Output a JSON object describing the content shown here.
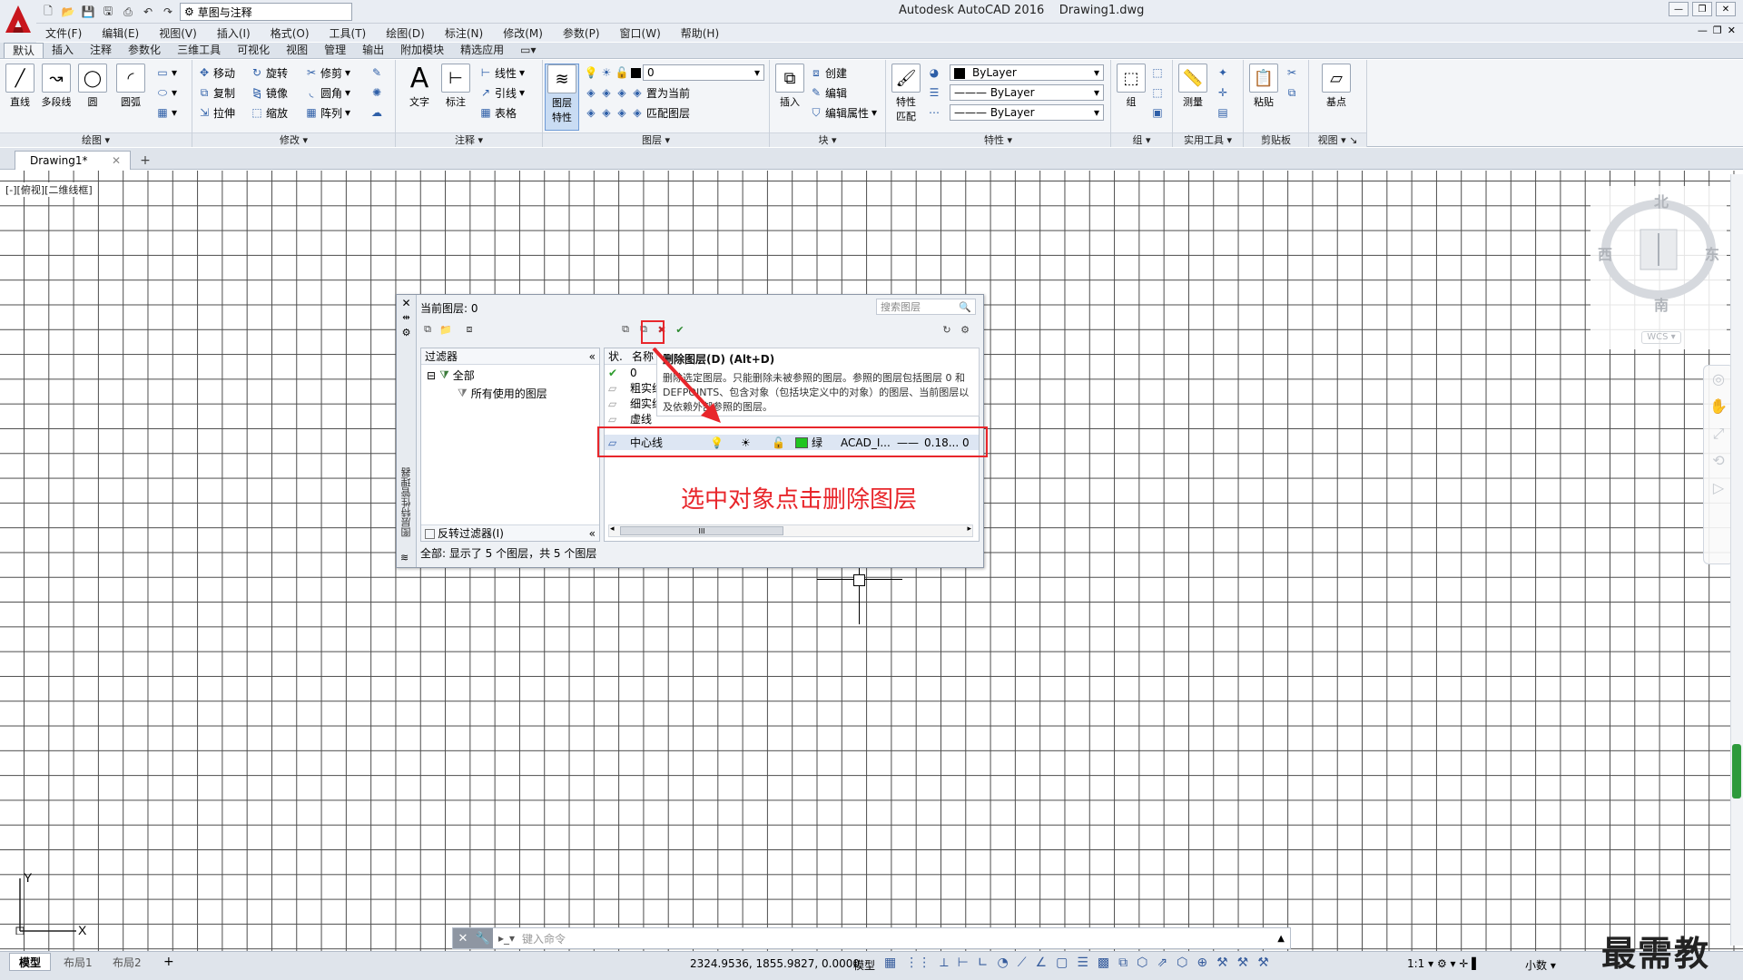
{
  "app": {
    "title": "Autodesk AutoCAD 2016    Drawing1.dwg",
    "workspace": "草图与注释"
  },
  "menus": [
    "文件(F)",
    "编辑(E)",
    "视图(V)",
    "插入(I)",
    "格式(O)",
    "工具(T)",
    "绘图(D)",
    "标注(N)",
    "修改(M)",
    "参数(P)",
    "窗口(W)",
    "帮助(H)"
  ],
  "ribbon_tabs": [
    "默认",
    "插入",
    "注释",
    "参数化",
    "三维工具",
    "可视化",
    "视图",
    "管理",
    "输出",
    "附加模块",
    "精选应用"
  ],
  "ribbon": {
    "draw": {
      "label": "绘图",
      "line": "直线",
      "polyline": "多段线",
      "circle": "圆",
      "arc": "圆弧"
    },
    "modify": {
      "label": "修改",
      "move": "移动",
      "rotate": "旋转",
      "trim": "修剪",
      "copy": "复制",
      "mirror": "镜像",
      "fillet": "圆角",
      "stretch": "拉伸",
      "scale": "缩放",
      "array": "阵列"
    },
    "annotation": {
      "label": "注释",
      "text": "文字",
      "dimension": "标注",
      "linear": "线性",
      "leader": "引线",
      "table": "表格"
    },
    "layers": {
      "label": "图层",
      "properties_line1": "图层",
      "properties_line2": "特性",
      "current_layer": "0",
      "set_current": "置为当前",
      "match": "匹配图层"
    },
    "block": {
      "label": "块",
      "insert": "插入",
      "create": "创建",
      "edit": "编辑",
      "edit_attr": "编辑属性"
    },
    "properties": {
      "label": "特性",
      "match_line1": "特性",
      "match_line2": "匹配",
      "color": "ByLayer",
      "linetype": "ByLayer",
      "lineweight": "ByLayer"
    },
    "groups": {
      "label": "组",
      "group": "组"
    },
    "utilities": {
      "label": "实用工具",
      "measure": "测量"
    },
    "clipboard": {
      "label": "剪贴板",
      "paste": "粘贴"
    },
    "view": {
      "label": "视图",
      "base": "基点"
    }
  },
  "document_tab": "Drawing1*",
  "viewport_label": "[-][俯视][二维线框]",
  "viewcube": {
    "north": "北",
    "south": "南",
    "east": "东",
    "west": "西",
    "wcs": "WCS"
  },
  "layer_manager": {
    "current_layer": "当前图层: 0",
    "search_placeholder": "搜索图层",
    "filter_header": "过滤器",
    "tree_all": "全部",
    "tree_used": "所有使用的图层",
    "invert_filter": "反转过滤器(I)",
    "col_status": "状.",
    "col_name": "名称",
    "palette_side_title": "图层特性管理器",
    "layers": [
      {
        "name": "0"
      },
      {
        "name": "粗实线"
      },
      {
        "name": "细实线"
      },
      {
        "name": "虚线"
      }
    ],
    "selected_layer": {
      "name": "中心线",
      "color": "绿",
      "linetype": "ACAD_I...",
      "lineweight": "0.18...",
      "transparency": "0"
    },
    "tooltip_title": "删除图层(D) (Alt+D)",
    "tooltip_body": "删除选定图层。只能删除未被参照的图层。参照的图层包括图层 0 和 DEFPOINTS、包含对象（包括块定义中的对象）的图层、当前图层以及依赖外部参照的图层。",
    "status": "全部: 显示了 5 个图层，共 5 个图层",
    "scroll_marker": "III"
  },
  "annotation_text": "选中对象点击删除图层",
  "command_line": {
    "placeholder": "键入命令"
  },
  "layout_tabs": [
    "模型",
    "布局1",
    "布局2"
  ],
  "statusbar": {
    "coords": "2324.9536, 1855.9827, 0.0000",
    "model": "模型",
    "scale": "1:1",
    "units": "小数"
  },
  "watermark": "最需教育",
  "colors": {
    "accent_red": "#e8262b",
    "layer_green": "#21c521",
    "grid": "#4c4c4c"
  }
}
